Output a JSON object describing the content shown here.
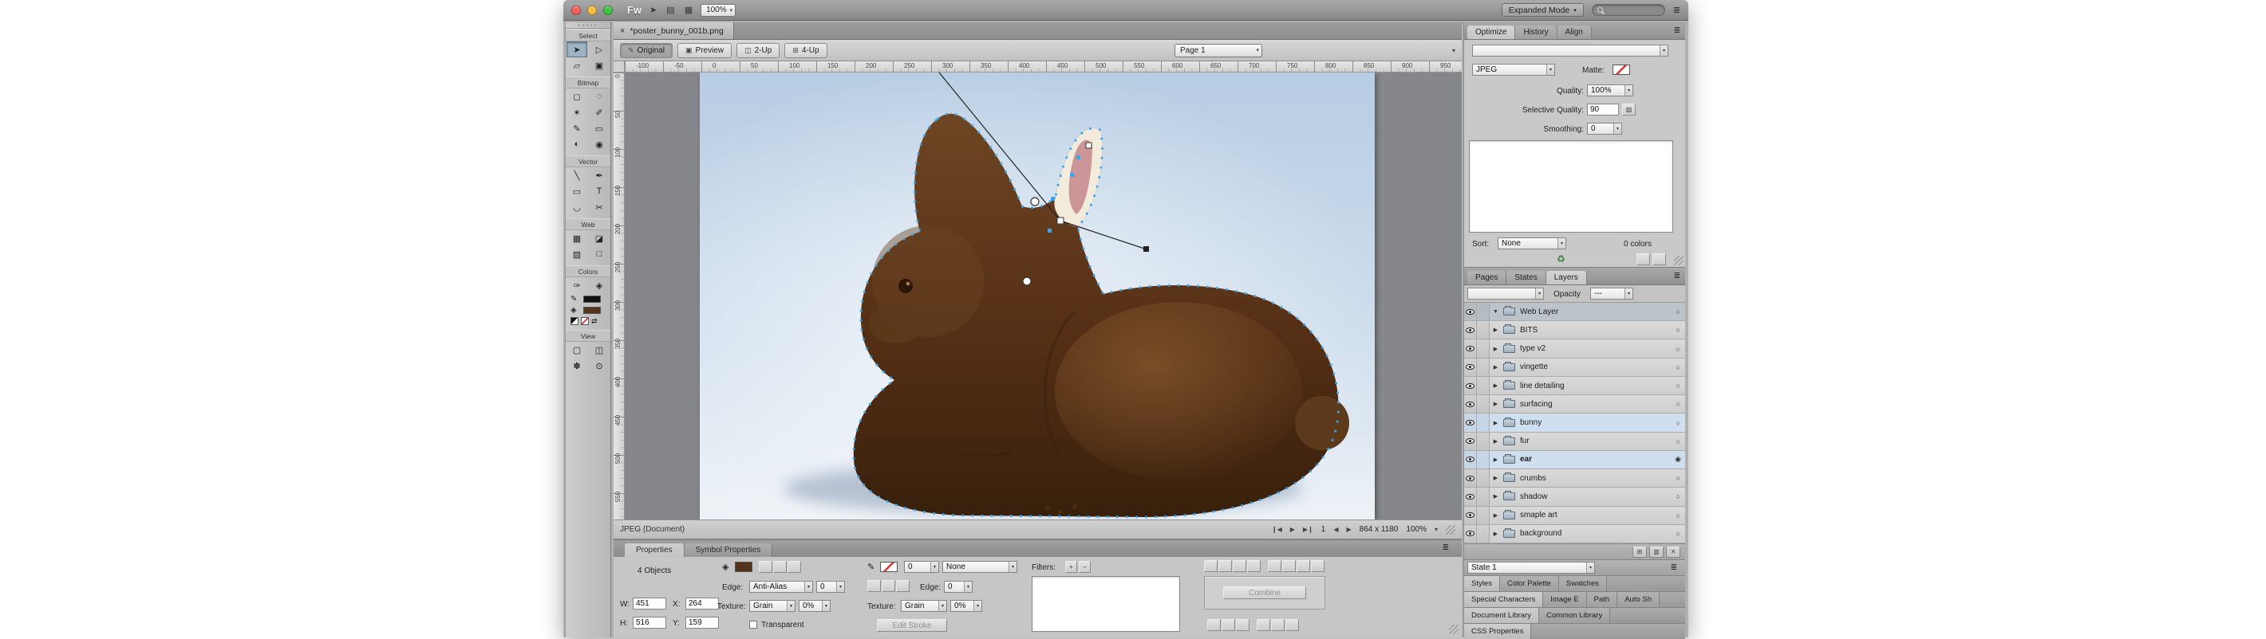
{
  "colors": {
    "selection_blue": "#39a5ec",
    "chocolate_dark": "#552f15",
    "canvas_sky_top": "#b7cde3",
    "layer_highlight": "#cfdff0"
  },
  "titlebar": {
    "app_logo": "Fw",
    "zoom_value": "100%",
    "mode_button_label": "Expanded Mode"
  },
  "icons": {
    "chevron_down": "▾",
    "panel_menu": "≣",
    "pointer": "➤",
    "doc": "▤",
    "grid": "▦",
    "close": "×",
    "expander_open": "▼",
    "expander_closed": "▶",
    "state_circle": "○",
    "state_circle_active": "◉",
    "plus": "+",
    "minus": "–",
    "recycle": "♻",
    "nav_first": "❙◀",
    "nav_play": "▶",
    "nav_last": "▶❙",
    "nav_prev": "◀",
    "nav_next": "▶",
    "pencil": "✎",
    "pen": "✒",
    "bucket": "◈",
    "swap_arrows": "⇄",
    "mask_edit": "▨"
  },
  "document": {
    "tab_title": "*poster_bunny_001b.png",
    "page_selector": "Page 1",
    "view_tabs": [
      {
        "label": "Original",
        "icon": "✎",
        "cls": "active"
      },
      {
        "label": "Preview",
        "icon": "▣",
        "cls": ""
      },
      {
        "label": "2-Up",
        "icon": "◫",
        "cls": ""
      },
      {
        "label": "4-Up",
        "icon": "⊞",
        "cls": ""
      }
    ]
  },
  "rulers": {
    "horizontal": [
      "-100",
      "-50",
      "0",
      "50",
      "100",
      "150",
      "200",
      "250",
      "300",
      "350",
      "400",
      "450",
      "500",
      "550",
      "600",
      "650",
      "700",
      "750",
      "800",
      "850",
      "900",
      "950"
    ],
    "vertical": [
      "0",
      "50",
      "100",
      "150",
      "200",
      "250",
      "300",
      "350",
      "400",
      "450",
      "500",
      "550"
    ]
  },
  "tools": {
    "sections": [
      {
        "label": "Select",
        "items": [
          {
            "name": "pointer-tool",
            "glyph": "➤",
            "cls": "active-tool"
          },
          {
            "name": "subselection-tool",
            "glyph": "▷",
            "cls": ""
          },
          {
            "name": "scale-tool",
            "glyph": "▱",
            "cls": ""
          },
          {
            "name": "crop-tool",
            "glyph": "▣",
            "cls": ""
          }
        ]
      },
      {
        "label": "Bitmap",
        "items": [
          {
            "name": "marquee-tool",
            "glyph": "◻",
            "cls": ""
          },
          {
            "name": "lasso-tool",
            "glyph": "◌",
            "cls": ""
          },
          {
            "name": "magic-wand-tool",
            "glyph": "✶",
            "cls": ""
          },
          {
            "name": "brush-tool",
            "glyph": "✐",
            "cls": ""
          },
          {
            "name": "pencil-tool",
            "glyph": "✎",
            "cls": ""
          },
          {
            "name": "eraser-tool",
            "glyph": "▭",
            "cls": ""
          },
          {
            "name": "blur-tool",
            "glyph": "◐",
            "cls": ""
          },
          {
            "name": "rubber-stamp-tool",
            "glyph": "◉",
            "cls": ""
          }
        ]
      },
      {
        "label": "Vector",
        "items": [
          {
            "name": "line-tool",
            "glyph": "╲",
            "cls": ""
          },
          {
            "name": "pen-tool",
            "glyph": "✒",
            "cls": ""
          },
          {
            "name": "rectangle-tool",
            "glyph": "▭",
            "cls": ""
          },
          {
            "name": "text-tool",
            "glyph": "T",
            "cls": ""
          },
          {
            "name": "freeform-tool",
            "glyph": "◡",
            "cls": ""
          },
          {
            "name": "knife-tool",
            "glyph": "✂",
            "cls": ""
          }
        ]
      },
      {
        "label": "Web",
        "items": [
          {
            "name": "hotspot-tool",
            "glyph": "▦",
            "cls": ""
          },
          {
            "name": "slice-tool",
            "glyph": "◪",
            "cls": ""
          },
          {
            "name": "hide-hotspots-tool",
            "glyph": "▧",
            "cls": ""
          },
          {
            "name": "show-hotspots-tool",
            "glyph": "□",
            "cls": ""
          }
        ]
      },
      {
        "label": "Colors",
        "items": [
          {
            "name": "eyedropper-tool",
            "glyph": "✑",
            "cls": ""
          },
          {
            "name": "paint-bucket-tool",
            "glyph": "◈",
            "cls": ""
          }
        ]
      },
      {
        "label": "View",
        "items": [
          {
            "name": "standard-screen-mode",
            "glyph": "▢",
            "cls": ""
          },
          {
            "name": "full-screen-mode",
            "glyph": "◫",
            "cls": ""
          },
          {
            "name": "hand-tool",
            "glyph": "✽",
            "cls": ""
          },
          {
            "name": "zoom-tool",
            "glyph": "⊙",
            "cls": ""
          }
        ]
      }
    ]
  },
  "status_bar": {
    "format": "JPEG (Document)",
    "page": "1",
    "size": "864 x 1180",
    "zoom": "100%"
  },
  "optimize": {
    "tabs": [
      {
        "label": "Optimize",
        "cls": "active"
      },
      {
        "label": "History",
        "cls": ""
      },
      {
        "label": "Align",
        "cls": ""
      }
    ],
    "format": "JPEG",
    "matte_label": "Matte:",
    "quality_label": "Quality:",
    "quality_value": "100%",
    "selective_label": "Selective Quality:",
    "selective_value": "90",
    "smoothing_label": "Smoothing:",
    "smoothing_value": "0",
    "sort_label": "Sort:",
    "sort_value": "None",
    "colors_count": "0 colors"
  },
  "layers": {
    "tabs": [
      {
        "label": "Pages",
        "cls": ""
      },
      {
        "label": "States",
        "cls": ""
      },
      {
        "label": "Layers",
        "cls": "active"
      }
    ],
    "opacity_label": "Opacity",
    "opacity_value": "---",
    "items": [
      {
        "name": "Web Layer"
      },
      {
        "name": "BITS"
      },
      {
        "name": "type v2"
      },
      {
        "name": "vingette"
      },
      {
        "name": "line detailing"
      },
      {
        "name": "surfacing"
      },
      {
        "name": "bunny"
      },
      {
        "name": "fur"
      },
      {
        "name": "ear"
      },
      {
        "name": "crumbs"
      },
      {
        "name": "shadow"
      },
      {
        "name": "smaple art"
      },
      {
        "name": "background"
      }
    ]
  },
  "properties": {
    "tabs": [
      {
        "label": "Properties",
        "cls": "active"
      },
      {
        "label": "Symbol Properties",
        "cls": ""
      }
    ],
    "selection_label": "4 Objects",
    "w_label": "W:",
    "w_value": "451",
    "x_label": "X:",
    "x_value": "264",
    "h_label": "H:",
    "h_value": "516",
    "y_label": "Y:",
    "y_value": "159",
    "fill_edge_label": "Edge:",
    "fill_edge_value": "Anti-Alias",
    "fill_edge_amount": "0",
    "fill_texture_label": "Texture:",
    "fill_texture_value": "Grain",
    "fill_texture_amount": "0%",
    "transparent_label": "Transparent",
    "stroke_size_value": "0",
    "stroke_category_value": "None",
    "stroke_edge_label": "Edge:",
    "stroke_edge_amount": "0",
    "stroke_texture_label": "Texture:",
    "stroke_texture_value": "Grain",
    "stroke_texture_amount": "0%",
    "edit_stroke_label": "Edit Stroke",
    "filters_label": "Filters:",
    "combine_label": "Combine"
  },
  "bottom_right": {
    "state_selector": "State 1",
    "style_tabs": [
      {
        "label": "Styles",
        "cls": "active"
      },
      {
        "label": "Color Palette",
        "cls": ""
      },
      {
        "label": "Swatches",
        "cls": ""
      }
    ],
    "panel_tabs_row1": [
      {
        "label": "Special Characters",
        "cls": "active"
      },
      {
        "label": "Image E",
        "cls": ""
      },
      {
        "label": "Path",
        "cls": ""
      },
      {
        "label": "Auto Sh",
        "cls": ""
      }
    ],
    "panel_tabs_row2": [
      {
        "label": "Document Library",
        "cls": "active"
      },
      {
        "label": "Common Library",
        "cls": ""
      }
    ],
    "panel_tabs_row3": [
      {
        "label": "CSS Properties",
        "cls": "active"
      }
    ]
  }
}
